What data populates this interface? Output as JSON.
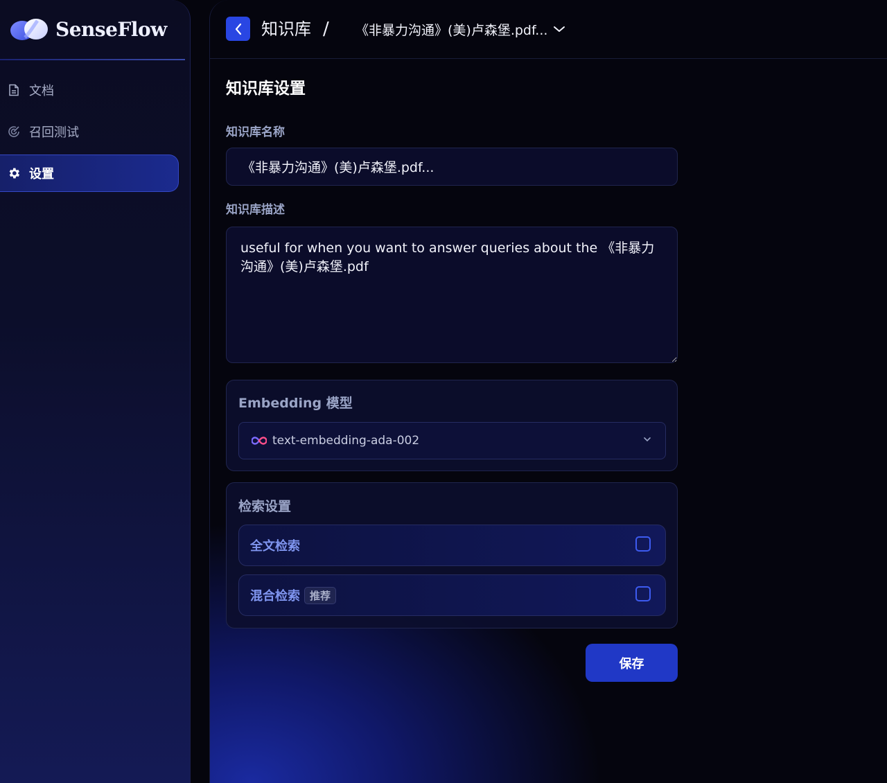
{
  "brand": {
    "name": "SenseFlow"
  },
  "sidebar": {
    "items": [
      {
        "label": "文档",
        "icon": "document-icon"
      },
      {
        "label": "召回测试",
        "icon": "target-icon"
      },
      {
        "label": "设置",
        "icon": "gear-icon",
        "active": true
      }
    ]
  },
  "breadcrumb": {
    "root": "知识库",
    "separator": "/",
    "current": "《非暴力沟通》(美)卢森堡.pdf..."
  },
  "page": {
    "title": "知识库设置"
  },
  "form": {
    "name_label": "知识库名称",
    "name_value": "《非暴力沟通》(美)卢森堡.pdf...",
    "desc_label": "知识库描述",
    "desc_value": "useful for when you want to answer queries about the 《非暴力沟通》(美)卢森堡.pdf"
  },
  "embedding": {
    "title": "Embedding 模型",
    "selected_model": "text-embedding-ada-002"
  },
  "retrieval": {
    "title": "检索设置",
    "options": [
      {
        "label": "全文检索",
        "checked": false
      },
      {
        "label": "混合检索",
        "badge": "推荐",
        "checked": false
      }
    ]
  },
  "actions": {
    "save_label": "保存"
  },
  "colors": {
    "accent": "#2946e3",
    "save_button": "#2038c6",
    "option_label": "#7f95ef"
  }
}
